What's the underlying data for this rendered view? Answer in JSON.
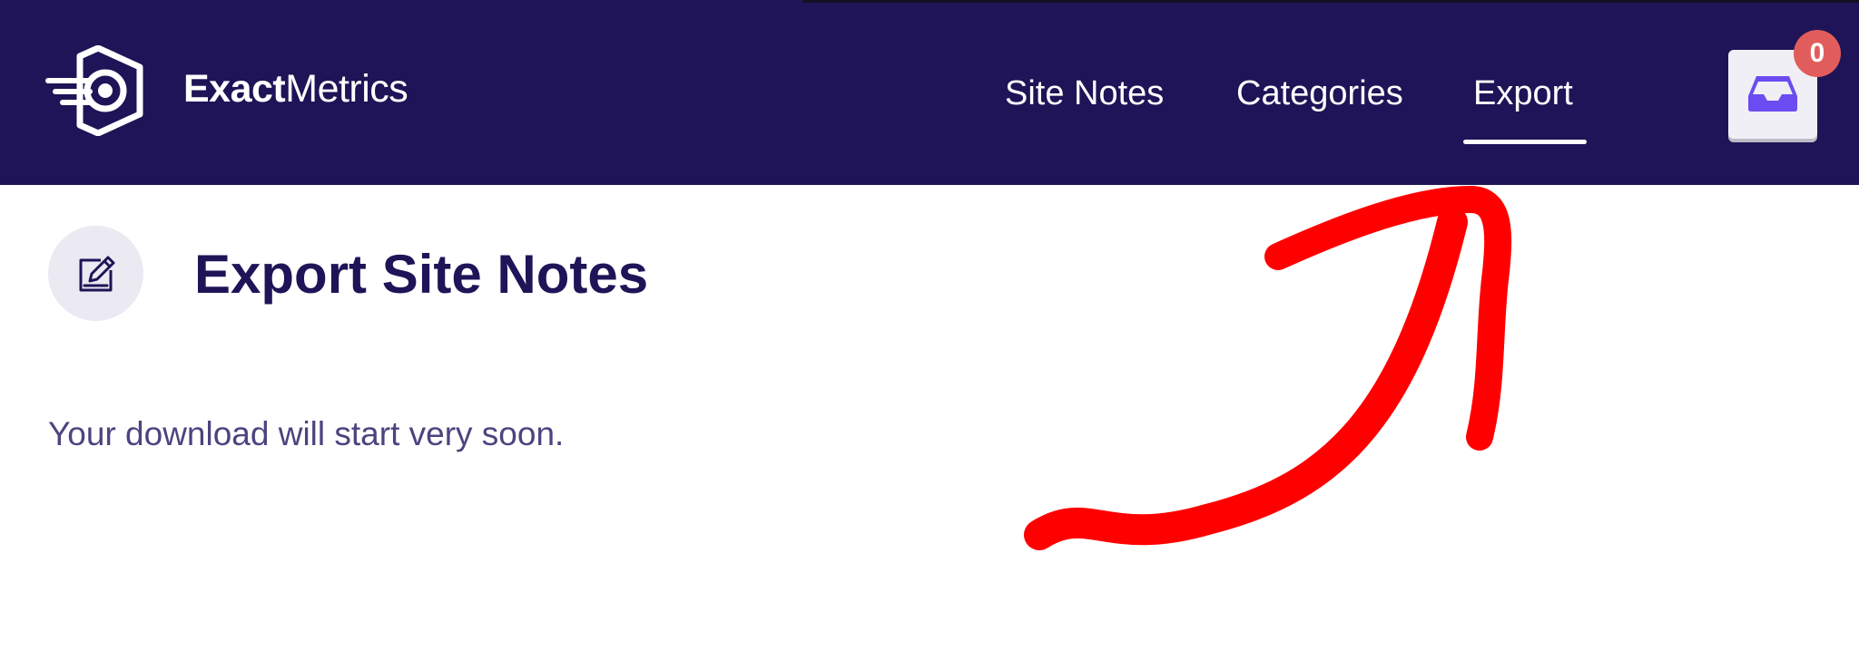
{
  "brand": {
    "name_bold": "Exact",
    "name_regular": "Metrics",
    "icon": "exactmetrics-logo-icon"
  },
  "nav": {
    "items": [
      {
        "label": "Site Notes",
        "active": false
      },
      {
        "label": "Categories",
        "active": false
      },
      {
        "label": "Export",
        "active": true
      }
    ]
  },
  "notifications": {
    "icon": "inbox-icon",
    "count": "0"
  },
  "main": {
    "title_icon": "edit-note-icon",
    "title": "Export Site Notes",
    "status_message": "Your download will start very soon."
  },
  "annotation": {
    "type": "hand-drawn-arrow",
    "color": "#ff0000",
    "points_to": "Export"
  },
  "colors": {
    "header_bg": "#1f1457",
    "accent": "#6b4cf0",
    "badge": "#e15d5b",
    "title_text": "#1f1457",
    "body_text": "#4c447e"
  }
}
